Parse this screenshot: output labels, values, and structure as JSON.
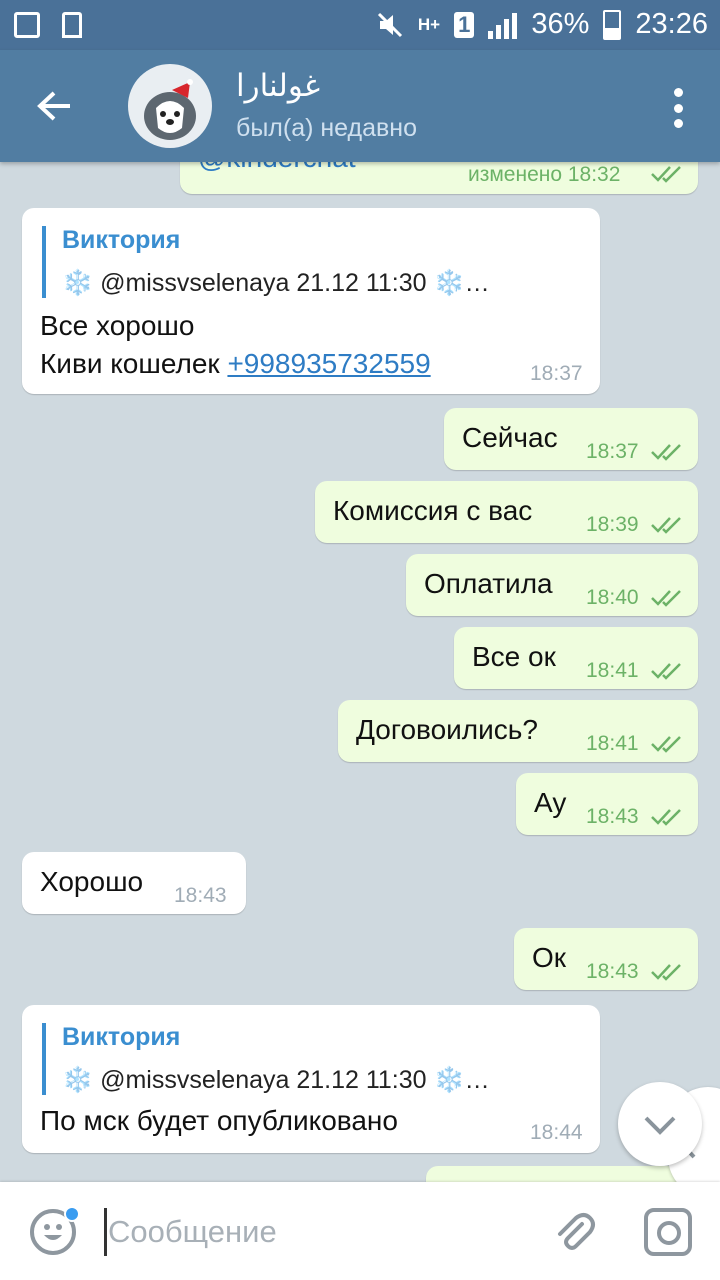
{
  "status_bar": {
    "network": "H+",
    "sim": "1",
    "battery": "36%",
    "time": "23:26"
  },
  "header": {
    "title": "غولنارا",
    "subtitle": "был(а) недавно"
  },
  "chat": {
    "top_partial": {
      "text": "@kinderchat",
      "time": "изменено 18:32"
    },
    "quote1": {
      "name": "Виктория",
      "text": "❄️ @missvselenaya    21.12    11:30 ❄️…",
      "line1": "Все хорошо",
      "line2_prefix": "Киви кошелек ",
      "link": "+998935732559",
      "time": "18:37"
    },
    "m1": {
      "text": "Сейчас",
      "time": "18:37"
    },
    "m2": {
      "text": "Комиссия с вас",
      "time": "18:39"
    },
    "m3": {
      "text": "Оплатила",
      "time": "18:40"
    },
    "m4": {
      "text": "Все ок",
      "time": "18:41"
    },
    "m5": {
      "text": "Договоились?",
      "time": "18:41"
    },
    "m6": {
      "text": "Ау",
      "time": "18:43"
    },
    "m7": {
      "text": "Хорошо",
      "time": "18:43"
    },
    "m8": {
      "text": "Ок",
      "time": "18:43"
    },
    "quote2": {
      "name": "Виктория",
      "text": "❄️ @missvselenaya    21.12    11:30 ❄️…",
      "line1": "По мск будет опубликовано",
      "time": "18:44"
    }
  },
  "input": {
    "placeholder": "Сообщение",
    "value": ""
  },
  "colors": {
    "header": "#517da2",
    "status_bar": "#4a7198",
    "outgoing": "#effdde",
    "incoming": "#ffffff",
    "accent": "#3a8ed0",
    "time_out": "#6cb267"
  },
  "icons": [
    "back-arrow-icon",
    "more-vert-icon",
    "double-check-icon",
    "chevron-left-icon",
    "chevron-down-icon",
    "emoji-icon",
    "attach-icon",
    "camera-icon"
  ]
}
